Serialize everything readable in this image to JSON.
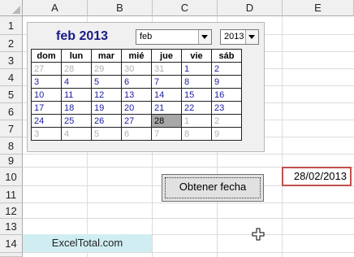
{
  "columns": [
    "A",
    "B",
    "C",
    "D",
    "E"
  ],
  "rows": [
    "1",
    "2",
    "3",
    "4",
    "5",
    "6",
    "7",
    "8",
    "9",
    "10",
    "11",
    "12",
    "13",
    "14"
  ],
  "calendar": {
    "title": "feb 2013",
    "month_select": "feb",
    "year_select": "2013",
    "weekdays": [
      "dom",
      "lun",
      "mar",
      "mié",
      "jue",
      "vie",
      "sáb"
    ],
    "weeks": [
      [
        {
          "d": "27",
          "o": true
        },
        {
          "d": "28",
          "o": true
        },
        {
          "d": "29",
          "o": true
        },
        {
          "d": "30",
          "o": true
        },
        {
          "d": "31",
          "o": true
        },
        {
          "d": "1"
        },
        {
          "d": "2"
        }
      ],
      [
        {
          "d": "3"
        },
        {
          "d": "4"
        },
        {
          "d": "5"
        },
        {
          "d": "6"
        },
        {
          "d": "7"
        },
        {
          "d": "8"
        },
        {
          "d": "9"
        }
      ],
      [
        {
          "d": "10"
        },
        {
          "d": "11"
        },
        {
          "d": "12"
        },
        {
          "d": "13"
        },
        {
          "d": "14"
        },
        {
          "d": "15"
        },
        {
          "d": "16"
        }
      ],
      [
        {
          "d": "17"
        },
        {
          "d": "18"
        },
        {
          "d": "19"
        },
        {
          "d": "20"
        },
        {
          "d": "21"
        },
        {
          "d": "22"
        },
        {
          "d": "23"
        }
      ],
      [
        {
          "d": "24"
        },
        {
          "d": "25"
        },
        {
          "d": "26"
        },
        {
          "d": "27"
        },
        {
          "d": "28",
          "s": true
        },
        {
          "d": "1",
          "o": true
        },
        {
          "d": "2",
          "o": true
        }
      ],
      [
        {
          "d": "3",
          "o": true
        },
        {
          "d": "4",
          "o": true
        },
        {
          "d": "5",
          "o": true
        },
        {
          "d": "6",
          "o": true
        },
        {
          "d": "7",
          "o": true
        },
        {
          "d": "8",
          "o": true
        },
        {
          "d": "9",
          "o": true
        }
      ]
    ]
  },
  "button_label": "Obtener fecha",
  "date_value": "28/02/2013",
  "footer_text": "ExcelTotal.com",
  "colors": {
    "date_border": "#c0504d",
    "footer_fill": "#d0eef2",
    "day_text": "#1a1aa0"
  }
}
